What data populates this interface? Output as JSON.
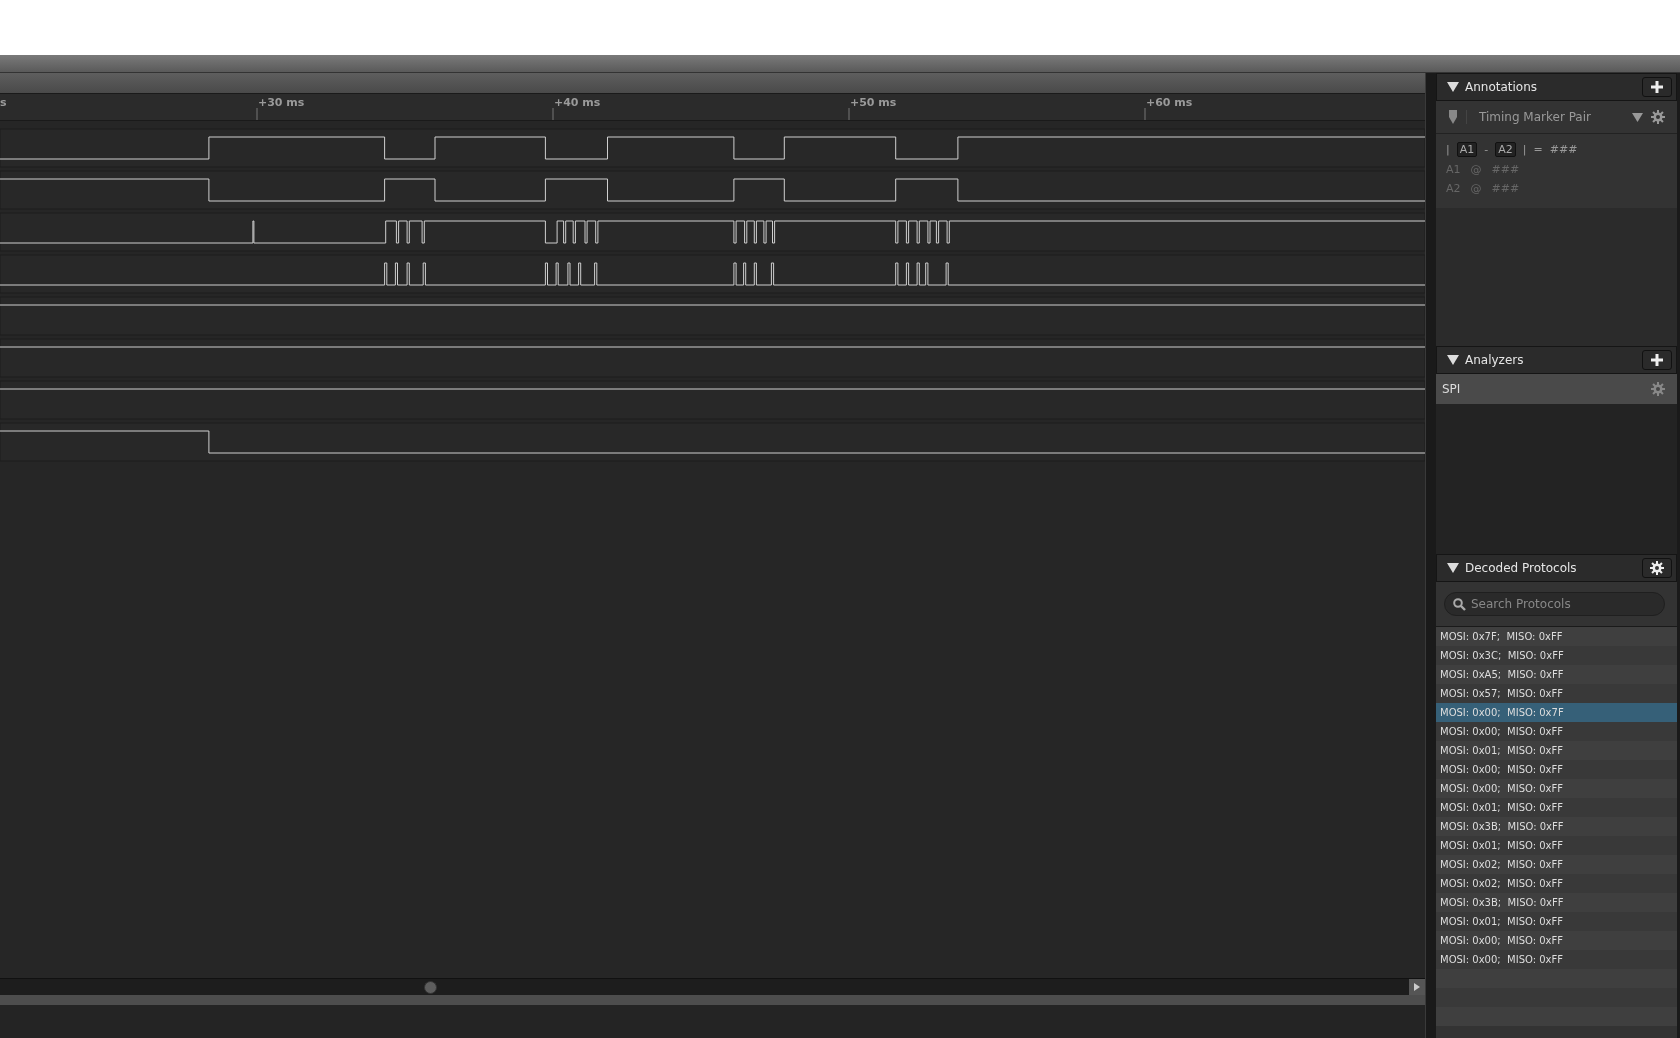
{
  "ruler": {
    "labels": [
      {
        "text": "s",
        "kind": "clipped"
      },
      {
        "text": "+30 ms",
        "kind": "tick"
      },
      {
        "text": "+40 ms",
        "kind": "tick"
      },
      {
        "text": "+50 ms",
        "kind": "tick"
      },
      {
        "text": "+60 ms",
        "kind": "tick"
      }
    ]
  },
  "annotations": {
    "title": "Annotations",
    "marker_type": "Timing Marker Pair",
    "formula": {
      "left_bar": "|",
      "a": "A1",
      "minus": "-",
      "b": "A2",
      "right_bar": "|",
      "equals": "=",
      "value": "###"
    },
    "markers": [
      {
        "name": "A1",
        "at": "@",
        "value": "###"
      },
      {
        "name": "A2",
        "at": "@",
        "value": "###"
      }
    ]
  },
  "analyzers": {
    "title": "Analyzers",
    "items": [
      {
        "name": "SPI"
      }
    ]
  },
  "decoded_protocols": {
    "title": "Decoded Protocols",
    "search": {
      "placeholder": "Search Protocols"
    },
    "rows": [
      {
        "text": "MOSI: 0x7F;  MISO: 0xFF",
        "selected": false
      },
      {
        "text": "MOSI: 0x3C;  MISO: 0xFF",
        "selected": false
      },
      {
        "text": "MOSI: 0xA5;  MISO: 0xFF",
        "selected": false
      },
      {
        "text": "MOSI: 0x57;  MISO: 0xFF",
        "selected": false
      },
      {
        "text": "MOSI: 0x00;  MISO: 0x7F",
        "selected": true
      },
      {
        "text": "MOSI: 0x00;  MISO: 0xFF",
        "selected": false
      },
      {
        "text": "MOSI: 0x01;  MISO: 0xFF",
        "selected": false
      },
      {
        "text": "MOSI: 0x00;  MISO: 0xFF",
        "selected": false
      },
      {
        "text": "MOSI: 0x00;  MISO: 0xFF",
        "selected": false
      },
      {
        "text": "MOSI: 0x01;  MISO: 0xFF",
        "selected": false
      },
      {
        "text": "MOSI: 0x3B;  MISO: 0xFF",
        "selected": false
      },
      {
        "text": "MOSI: 0x01;  MISO: 0xFF",
        "selected": false
      },
      {
        "text": "MOSI: 0x02;  MISO: 0xFF",
        "selected": false
      },
      {
        "text": "MOSI: 0x02;  MISO: 0xFF",
        "selected": false
      },
      {
        "text": "MOSI: 0x3B;  MISO: 0xFF",
        "selected": false
      },
      {
        "text": "MOSI: 0x01;  MISO: 0xFF",
        "selected": false
      },
      {
        "text": "MOSI: 0x00;  MISO: 0xFF",
        "selected": false
      },
      {
        "text": "MOSI: 0x00;  MISO: 0xFF",
        "selected": false
      }
    ]
  }
}
